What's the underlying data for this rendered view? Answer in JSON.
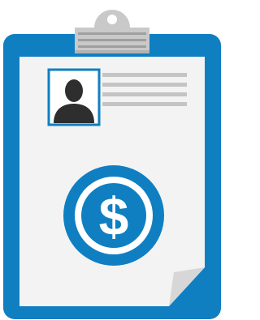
{
  "illustration": {
    "subject": "clipboard-with-dollar-form",
    "symbol": "$",
    "icons": [
      "clip-icon",
      "person-silhouette-icon",
      "dollar-coin-icon",
      "folded-corner-icon"
    ]
  },
  "colors": {
    "board": "#0f7fc2",
    "paper": "#f3f3f3",
    "clip": "#c9c9c9",
    "clip_shadow": "#9f9f9f",
    "lines": "#c4c4c4",
    "photo_bg": "#ffffff",
    "silhouette": "#2e2e2e",
    "coin": "#0f7fc2",
    "fold": "#d7d7d7"
  }
}
